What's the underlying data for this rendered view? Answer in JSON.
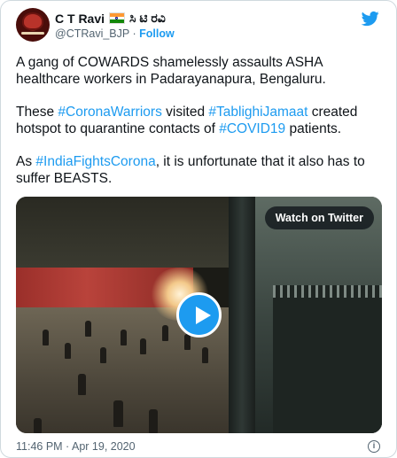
{
  "author": {
    "name": "C T Ravi",
    "flag": "india-flag",
    "name_native": "ಸಿ ಟಿ ರವಿ",
    "handle": "@CTRavi_BJP",
    "separator": "·",
    "follow_label": "Follow"
  },
  "tweet": {
    "p1": "A gang of COWARDS shamelessly assaults ASHA healthcare workers in Padarayanapura, Bengaluru.",
    "p2_a": "These ",
    "p2_tag1": "#CoronaWarriors",
    "p2_b": " visited ",
    "p2_tag2": "#TablighiJamaat",
    "p2_c": " created hotspot to quarantine contacts of ",
    "p2_tag3": "#COVID19",
    "p2_d": " patients.",
    "p3_a": "As ",
    "p3_tag1": "#IndiaFightsCorona",
    "p3_b": ", it is unfortunate that it also has to suffer BEASTS."
  },
  "video": {
    "watch_label": "Watch on Twitter",
    "play_icon": "play-icon"
  },
  "footer": {
    "timestamp": "11:46 PM · Apr 19, 2020",
    "info_icon": "info-icon"
  },
  "colors": {
    "link": "#1d9bf0",
    "text": "#0f1419",
    "muted": "#536471",
    "border": "#cfd9de"
  }
}
